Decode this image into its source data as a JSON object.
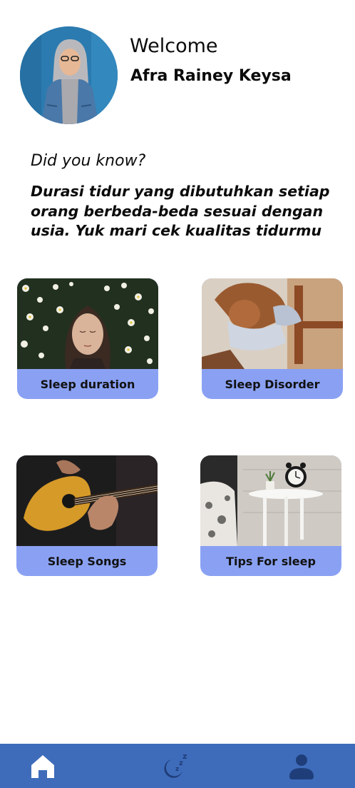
{
  "header": {
    "greeting": "Welcome",
    "user_name": "Afra Rainey Keysa",
    "avatar": "profile-photo-woman-denim-jacket"
  },
  "tip": {
    "heading": "Did you know?",
    "text": "Durasi tidur yang dibutuhkan setiap orang berbeda-beda sesuai dengan usia. Yuk mari cek kualitas tidurmu"
  },
  "cards": [
    {
      "label": "Sleep duration",
      "image": "woman-eyes-closed-flowers"
    },
    {
      "label": "Sleep Disorder",
      "image": "woman-sleeping-on-chair"
    },
    {
      "label": "Sleep Songs",
      "image": "hands-playing-guitar"
    },
    {
      "label": "Tips For sleep",
      "image": "alarm-clock-on-bedside-table"
    }
  ],
  "bottom_nav": [
    {
      "icon": "home-icon"
    },
    {
      "icon": "sleep-moon-icon"
    },
    {
      "icon": "profile-icon"
    }
  ],
  "colors": {
    "nav_background": "#3e6cbb",
    "card_label_background": "#8aa1f3",
    "text": "#0b0b0b"
  }
}
